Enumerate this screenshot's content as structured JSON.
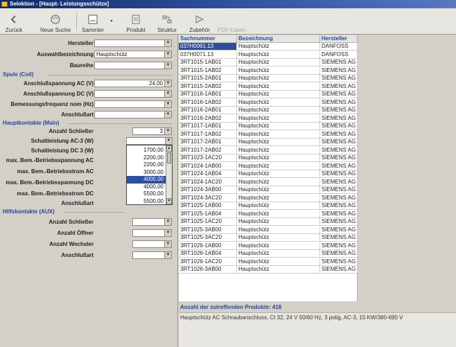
{
  "window": {
    "title": "Selektion - [Haupt- Leistungsschütze]"
  },
  "toolbar": {
    "back": "Zurück",
    "new_search": "Neue Suche",
    "collector": "Sammler",
    "product": "Produkt",
    "structure": "Struktur",
    "accessories": "Zubehör",
    "pdf": "PDF-Daten"
  },
  "filters": {
    "manufacturer_label": "Hersteller",
    "selection_label": "Auswahlbezeichnung",
    "selection_value": "Hauptschütz",
    "series_label": "Baureihe",
    "coil_group": "Spule (Coil)",
    "voltage_ac_label": "Anschlußspannung AC (V)",
    "voltage_ac_value": "24,00",
    "voltage_dc_label": "Anschlußspannung DC (V)",
    "freq_label": "Bemessungsfrequenz nom (Hz)",
    "conn_type_label": "Anschlußart",
    "main_group": "Hauptkontakte (Main)",
    "closers_label": "Anzahl Schließer",
    "closers_value": "3",
    "power_ac3_label": "Schaltleistung AC-3 (W)",
    "power_dc3_label": "Schaltleistung DC 3 (W)",
    "max_voltage_ac_label": "max. Bem.-Betriebsspannung AC",
    "max_current_ac_label": "max. Bem.-Betriebsstrom AC",
    "max_voltage_dc_label": "max. Bem.-Betriebsspannung DC",
    "max_current_dc_label": "max. Bem.-Betriebsstrom DC",
    "main_conn_label": "Anschlußart",
    "aux_group": "Hilfskontakte (AUX)",
    "aux_closers_label": "Anzahl Schließer",
    "aux_openers_label": "Anzahl Öffner",
    "aux_changers_label": "Anzahl Wechsler",
    "aux_conn_label": "Anschlußart"
  },
  "dropdown": {
    "options": [
      "1700,00",
      "2200,00",
      "2200,00",
      "3000,00",
      "4000,00",
      "4000,00",
      "5500,00",
      "5500,00"
    ],
    "selected_index": 4
  },
  "table": {
    "columns": [
      "Sachnummer",
      "Bezeichnung",
      "Hersteller"
    ],
    "rows": [
      [
        "037H0061.13",
        "Hauptschütz",
        "DANFOSS"
      ],
      [
        "037H0071.13",
        "Hauptschütz",
        "DANFOSS"
      ],
      [
        "3RT1015-1AB01",
        "Hauptschütz",
        "SIEMENS AG"
      ],
      [
        "3RT1015-1AB02",
        "Hauptschütz",
        "SIEMENS AG"
      ],
      [
        "3RT1015-2AB01",
        "Hauptschütz",
        "SIEMENS AG"
      ],
      [
        "3RT1015-2AB02",
        "Hauptschütz",
        "SIEMENS AG"
      ],
      [
        "3RT1016-1AB01",
        "Hauptschütz",
        "SIEMENS AG"
      ],
      [
        "3RT1016-1AB02",
        "Hauptschütz",
        "SIEMENS AG"
      ],
      [
        "3RT1016-2AB01",
        "Hauptschütz",
        "SIEMENS AG"
      ],
      [
        "3RT1016-2AB02",
        "Hauptschütz",
        "SIEMENS AG"
      ],
      [
        "3RT1017-1AB01",
        "Hauptschütz",
        "SIEMENS AG"
      ],
      [
        "3RT1017-1AB02",
        "Hauptschütz",
        "SIEMENS AG"
      ],
      [
        "3RT1017-2AB01",
        "Hauptschütz",
        "SIEMENS AG"
      ],
      [
        "3RT1017-2AB02",
        "Hauptschütz",
        "SIEMENS AG"
      ],
      [
        "3RT1023-1AC20",
        "Hauptschütz",
        "SIEMENS AG"
      ],
      [
        "3RT1024-1AB00",
        "Hauptschütz",
        "SIEMENS AG"
      ],
      [
        "3RT1024-1AB04",
        "Hauptschütz",
        "SIEMENS AG"
      ],
      [
        "3RT1024-1AC20",
        "Hauptschütz",
        "SIEMENS AG"
      ],
      [
        "3RT1024-3AB00",
        "Hauptschütz",
        "SIEMENS AG"
      ],
      [
        "3RT1024-3AC20",
        "Hauptschütz",
        "SIEMENS AG"
      ],
      [
        "3RT1025-1AB00",
        "Hauptschütz",
        "SIEMENS AG"
      ],
      [
        "3RT1025-1AB04",
        "Hauptschütz",
        "SIEMENS AG"
      ],
      [
        "3RT1025-1AC20",
        "Hauptschütz",
        "SIEMENS AG"
      ],
      [
        "3RT1025-3AB00",
        "Hauptschütz",
        "SIEMENS AG"
      ],
      [
        "3RT1025-3AC20",
        "Hauptschütz",
        "SIEMENS AG"
      ],
      [
        "3RT1026-1AB00",
        "Hauptschütz",
        "SIEMENS AG"
      ],
      [
        "3RT1026-1AB04",
        "Hauptschütz",
        "SIEMENS AG"
      ],
      [
        "3RT1026-1AC20",
        "Hauptschütz",
        "SIEMENS AG"
      ],
      [
        "3RT1026-3AB00",
        "Hauptschütz",
        "SIEMENS AG"
      ]
    ],
    "selected_row": 0
  },
  "status": {
    "count": "Anzahl der zutreffenden Produkte: 418",
    "description": "Hauptschütz AC Schraubanschluss, Ct 32, 24 V 50/60 Hz, 3 polig, AC-3, 15 KW/380-690 V"
  }
}
